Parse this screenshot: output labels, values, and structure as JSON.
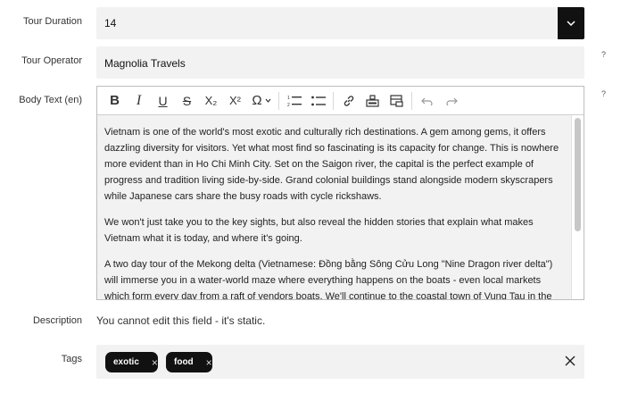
{
  "fields": {
    "duration": {
      "label": "Tour Duration",
      "value": "14"
    },
    "operator": {
      "label": "Tour Operator",
      "value": "Magnolia Travels",
      "help": "?"
    },
    "body": {
      "label": "Body Text (en)",
      "help": "?",
      "toolbar": {
        "bold": "B",
        "italic": "I",
        "underline": "U",
        "strike": "S",
        "subscript": "X₂",
        "superscript": "X²",
        "special_chars": "Ω"
      },
      "paragraphs": [
        "Vietnam is one of the world's most exotic and culturally rich destinations. A gem among gems, it offers dazzling diversity for visitors. Yet what most find so fascinating is its capacity for change. This is nowhere more evident than in Ho Chi Minh City. Set on the Saigon river, the capital is the perfect example of progress and tradition living side-by-side. Grand colonial buildings stand alongside modern skyscrapers while Japanese cars share the busy roads with cycle rickshaws.",
        "We won't just take you to the key sights, but also reveal the hidden stories that explain what makes Vietnam what it is today, and where it's going.",
        "A two day tour of the Mekong delta (Vietnamese: Đồng bằng Sông Cửu Long \"Nine Dragon river delta\") will immerse you in a water-world maze where everything happens on the boats - even local markets which form every day from a raft of vendors boats. We'll continue to the coastal town of Vung Tau in the Phuong"
      ],
      "scroll_position": 0
    },
    "description": {
      "label": "Description",
      "value": "You cannot edit this field - it's static."
    },
    "tags": {
      "label": "Tags",
      "items": [
        "exotic",
        "food"
      ]
    }
  },
  "colors": {
    "field_bg": "#f2f2f2",
    "tag_bg": "#111111",
    "accent": "#111111"
  },
  "icons": [
    "chevron-down-icon",
    "ordered-list-icon",
    "bullet-list-icon",
    "link-icon",
    "embed-icon",
    "table-icon",
    "undo-icon",
    "redo-icon",
    "close-icon"
  ]
}
